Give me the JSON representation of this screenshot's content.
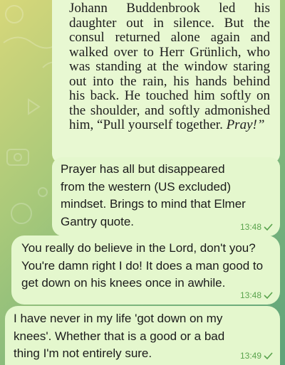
{
  "colors": {
    "bubble": "#e4f7cd",
    "time": "#5aa34d",
    "text": "#1b1b1b"
  },
  "quote": {
    "text": "Johann Buddenbrook led his daughter out in silence. But the consul returned alone again and walked over to Herr Grünlich, who was standing at the window staring out into the rain, his hands behind his back. He touched him softly on the shoulder, and softly admonished him, “Pull yourself together.",
    "emphasis": "Pray!”"
  },
  "messages": [
    {
      "text": "Prayer has all but disappeared from the western (US excluded) mindset. Brings to mind that Elmer Gantry quote.",
      "time": "13:48",
      "status_icon": "single-check-icon"
    },
    {
      "text": "You really do believe in the Lord, don't you? You're damn right I do! It does a man good to get down on his knees once in awhile.",
      "time": "13:48",
      "status_icon": "single-check-icon"
    },
    {
      "text": "I have never in my life 'got down on my knees'. Whether that is a good or a bad thing I'm not entirely sure.",
      "time": "13:49",
      "status_icon": "single-check-icon"
    }
  ]
}
